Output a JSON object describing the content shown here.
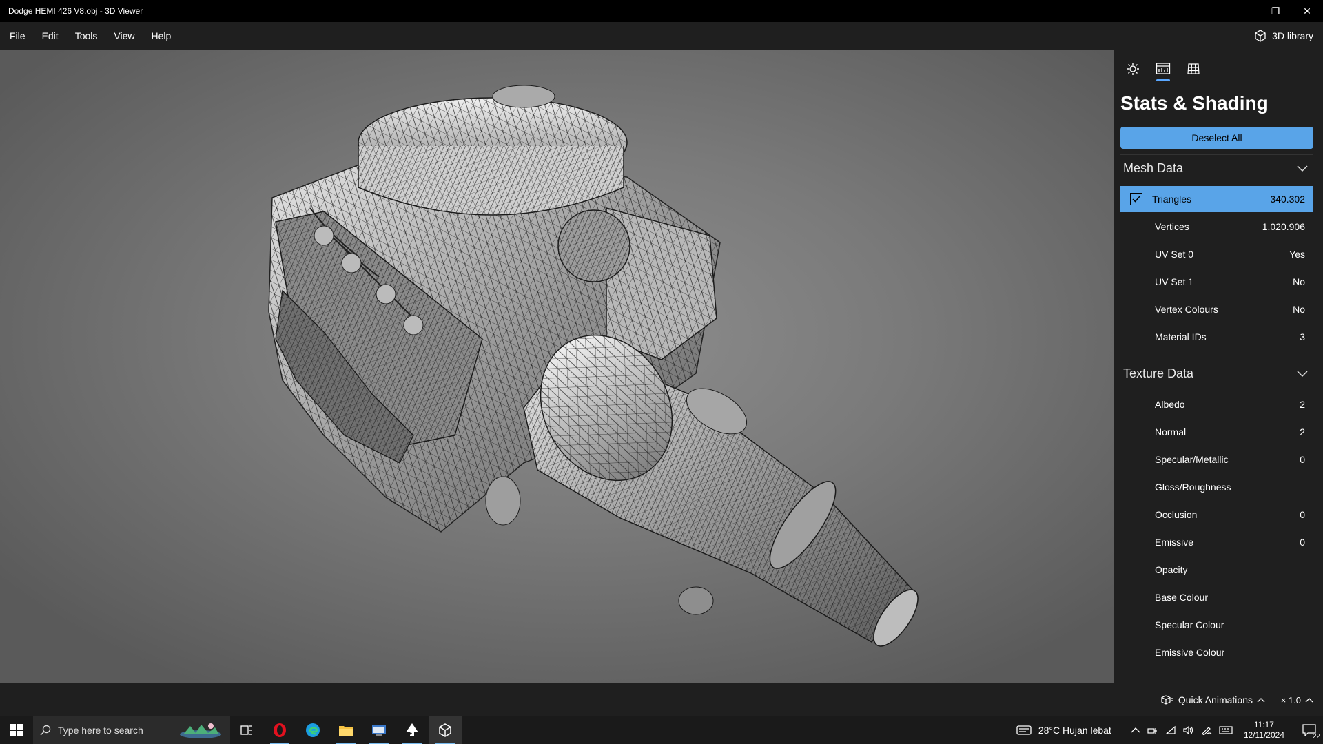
{
  "window": {
    "title": "Dodge HEMI 426 V8.obj - 3D Viewer",
    "minimize": "–",
    "restore": "❐",
    "close": "✕"
  },
  "menu": {
    "items": [
      "File",
      "Edit",
      "Tools",
      "View",
      "Help"
    ],
    "library_label": "3D library"
  },
  "panel": {
    "title": "Stats & Shading",
    "deselect_label": "Deselect All",
    "mesh_section": "Mesh Data",
    "mesh_rows": [
      {
        "name": "Triangles",
        "value": "340.302"
      },
      {
        "name": "Vertices",
        "value": "1.020.906"
      },
      {
        "name": "UV Set 0",
        "value": "Yes"
      },
      {
        "name": "UV Set 1",
        "value": "No"
      },
      {
        "name": "Vertex Colours",
        "value": "No"
      },
      {
        "name": "Material IDs",
        "value": "3"
      }
    ],
    "texture_section": "Texture Data",
    "texture_rows": [
      {
        "name": "Albedo",
        "value": "2"
      },
      {
        "name": "Normal",
        "value": "2"
      },
      {
        "name": "Specular/Metallic",
        "value": "0"
      },
      {
        "name": "Gloss/Roughness",
        "value": ""
      },
      {
        "name": "Occlusion",
        "value": "0"
      },
      {
        "name": "Emissive",
        "value": "0"
      },
      {
        "name": "Opacity",
        "value": ""
      },
      {
        "name": "Base Colour",
        "value": ""
      },
      {
        "name": "Specular Colour",
        "value": ""
      },
      {
        "name": "Emissive Colour",
        "value": ""
      }
    ]
  },
  "status": {
    "quick_animations": "Quick Animations",
    "speed": "× 1.0"
  },
  "taskbar": {
    "search_placeholder": "Type here to search",
    "weather": "28°C  Hujan lebat",
    "time": "11:17",
    "date": "12/11/2024",
    "notifications": "22"
  },
  "colors": {
    "accent": "#59a4e8",
    "panel_bg": "#1f1f1f",
    "viewport_bg": "#7a7a7a"
  }
}
